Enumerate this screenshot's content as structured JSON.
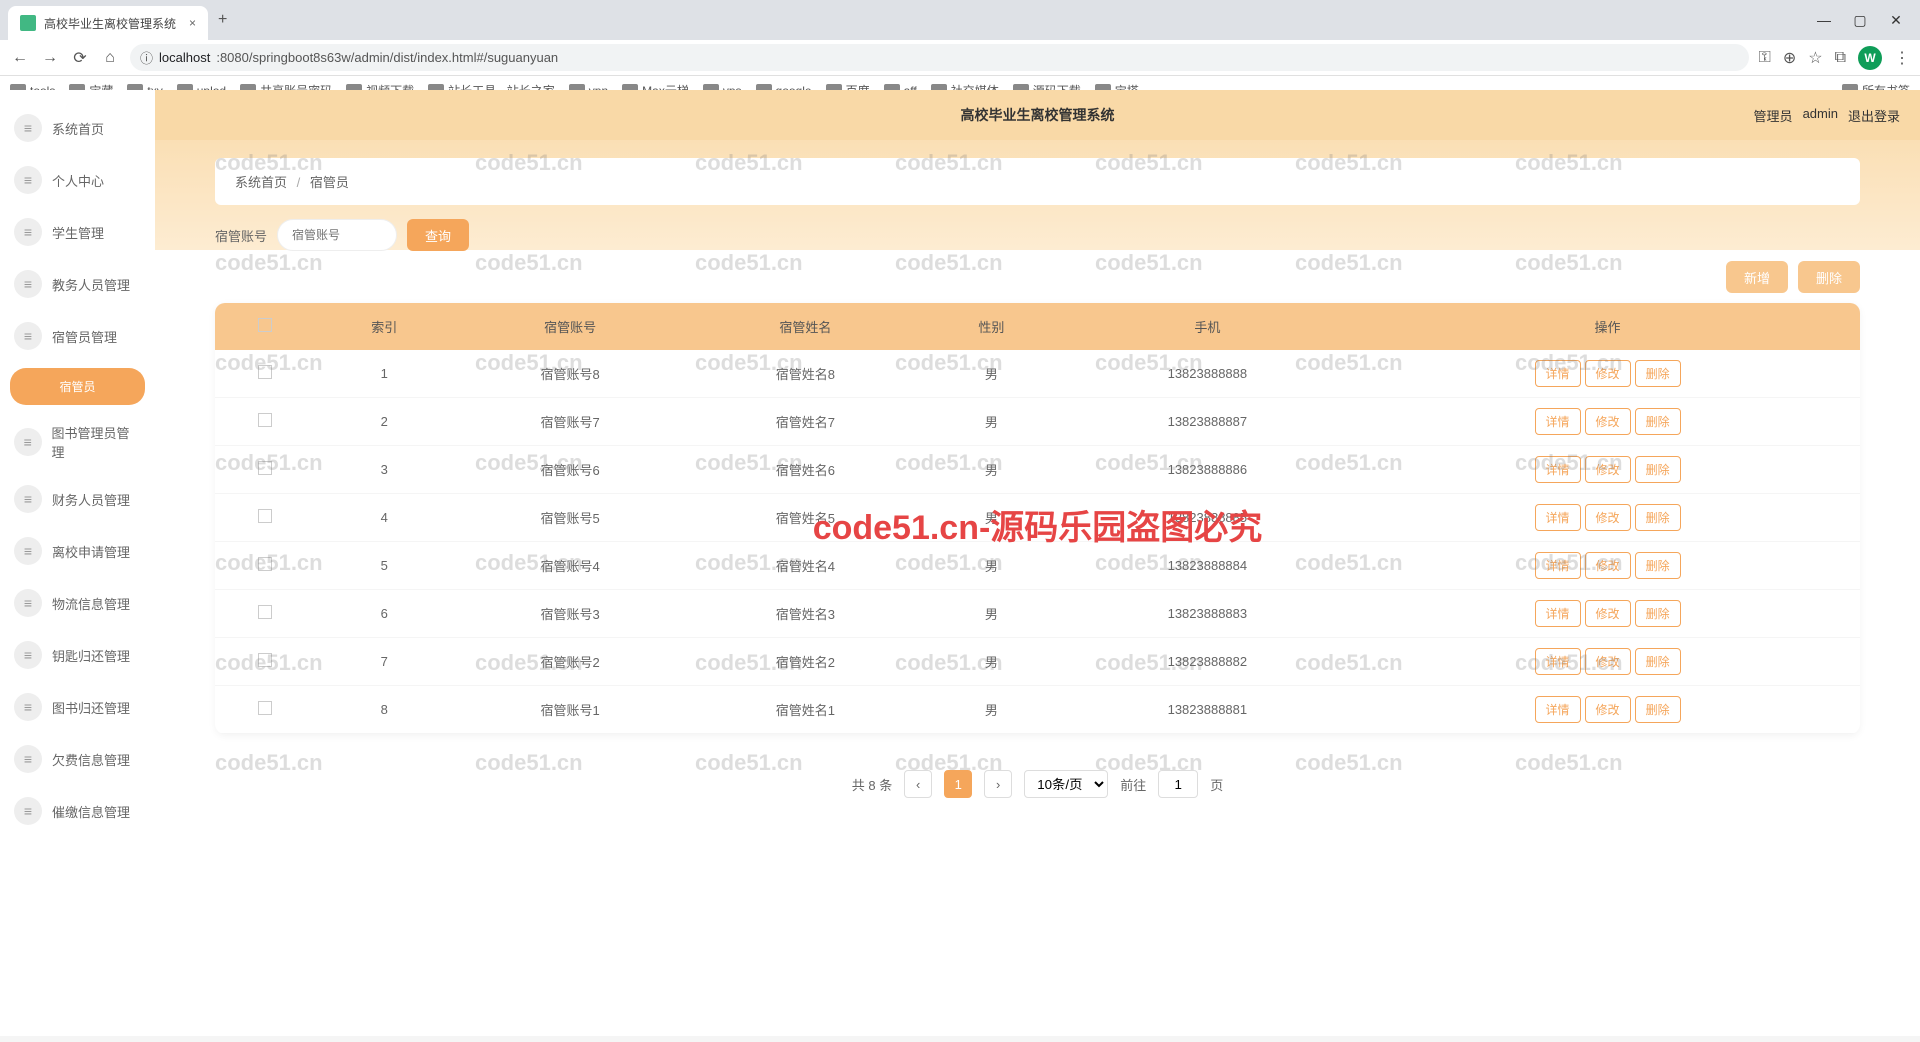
{
  "browser": {
    "tab_title": "高校毕业生离校管理系统",
    "url_host": "localhost",
    "url_path": ":8080/springboot8s63w/admin/dist/index.html#/suguanyuan",
    "new_tab": "+",
    "close": "×",
    "profile_initial": "W",
    "bookmarks": [
      "tools",
      "宝藏",
      "txy",
      "uplod",
      "共享账号密码",
      "视频下载",
      "站长工具 - 站长之家",
      "vpn",
      "Max云梯",
      "vps",
      "google",
      "百度",
      "aff",
      "社交媒体",
      "源码下载",
      "宝塔"
    ],
    "all_bookmarks": "所有书签"
  },
  "header": {
    "title": "高校毕业生离校管理系统",
    "role": "管理员",
    "username": "admin",
    "logout": "退出登录"
  },
  "sidebar": {
    "items": [
      "系统首页",
      "个人中心",
      "学生管理",
      "教务人员管理",
      "宿管员管理",
      "图书管理员管理",
      "财务人员管理",
      "离校申请管理",
      "物流信息管理",
      "钥匙归还管理",
      "图书归还管理",
      "欠费信息管理",
      "催缴信息管理"
    ],
    "submenu_label": "宿管员"
  },
  "breadcrumb": {
    "home": "系统首页",
    "current": "宿管员"
  },
  "search": {
    "label": "宿管账号",
    "placeholder": "宿管账号",
    "btn": "查询"
  },
  "actions": {
    "add": "新增",
    "delete": "删除"
  },
  "table": {
    "headers": [
      "索引",
      "宿管账号",
      "宿管姓名",
      "性别",
      "手机",
      "操作"
    ],
    "ops": {
      "detail": "详情",
      "edit": "修改",
      "delete": "删除"
    },
    "rows": [
      {
        "idx": "1",
        "account": "宿管账号8",
        "name": "宿管姓名8",
        "gender": "男",
        "phone": "13823888888"
      },
      {
        "idx": "2",
        "account": "宿管账号7",
        "name": "宿管姓名7",
        "gender": "男",
        "phone": "13823888887"
      },
      {
        "idx": "3",
        "account": "宿管账号6",
        "name": "宿管姓名6",
        "gender": "男",
        "phone": "13823888886"
      },
      {
        "idx": "4",
        "account": "宿管账号5",
        "name": "宿管姓名5",
        "gender": "男",
        "phone": "13823888885"
      },
      {
        "idx": "5",
        "account": "宿管账号4",
        "name": "宿管姓名4",
        "gender": "男",
        "phone": "13823888884"
      },
      {
        "idx": "6",
        "account": "宿管账号3",
        "name": "宿管姓名3",
        "gender": "男",
        "phone": "13823888883"
      },
      {
        "idx": "7",
        "account": "宿管账号2",
        "name": "宿管姓名2",
        "gender": "男",
        "phone": "13823888882"
      },
      {
        "idx": "8",
        "account": "宿管账号1",
        "name": "宿管姓名1",
        "gender": "男",
        "phone": "13823888881"
      }
    ]
  },
  "pagination": {
    "total_text": "共 8 条",
    "page_size": "10条/页",
    "current": "1",
    "goto_label": "前往",
    "goto_value": "1",
    "page_suffix": "页"
  },
  "watermark": {
    "text": "code51.cn",
    "red": "code51.cn-源码乐园盗图必究"
  }
}
